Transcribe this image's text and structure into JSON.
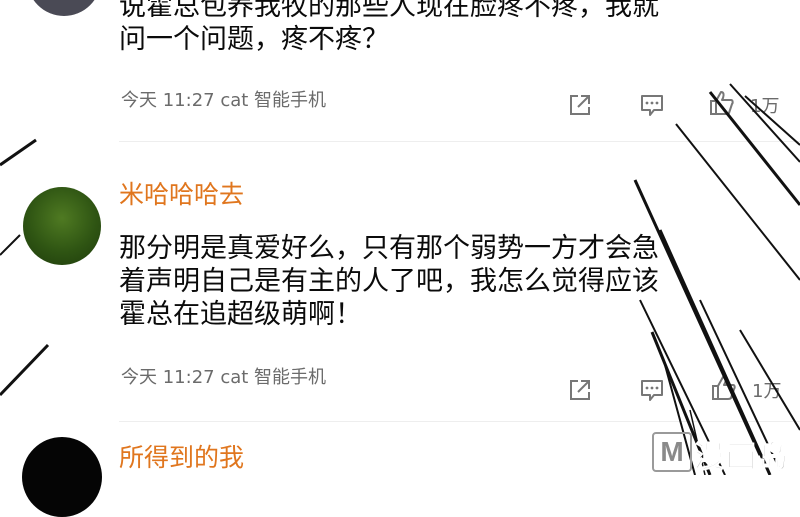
{
  "comments": [
    {
      "body_lines": [
        "说霍总包养我牧的那些人现在脸疼不疼，我就",
        "问一个问题，疼不疼？"
      ],
      "meta": "今天 11:27 cat 智能手机",
      "likes": "1万"
    },
    {
      "username": "米哈哈哈去",
      "body_lines": [
        "那分明是真爱好么，只有那个弱势一方才会急",
        "着声明自己是有主的人了吧，我怎么觉得应该",
        "霍总在追超级萌啊！"
      ],
      "meta": "今天 11:27 cat 智能手机",
      "likes": "1万"
    },
    {
      "username": "所得到的我"
    }
  ],
  "icons": {
    "share": "share-icon",
    "comment": "comment-icon",
    "like": "thumbs-up-icon"
  },
  "colors": {
    "username": "#e0761e",
    "meta": "#6b6b6b"
  },
  "watermark": {
    "letter": "M",
    "text": "漫画岛"
  }
}
